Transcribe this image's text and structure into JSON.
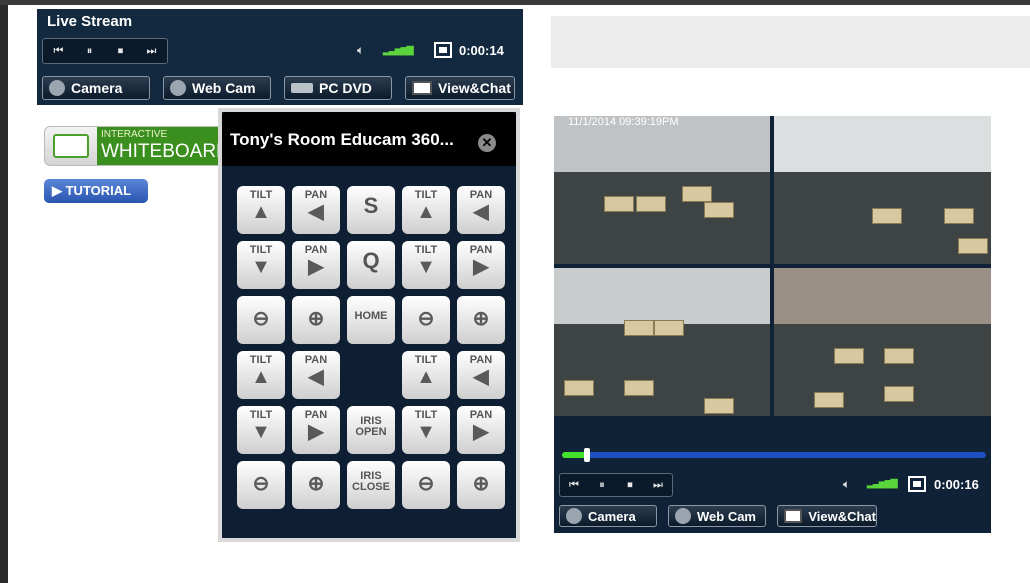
{
  "live": {
    "title": "Live Stream",
    "time": "0:00:14",
    "transport": [
      "⏮",
      "⏸",
      "⏹",
      "⏭"
    ],
    "sources": [
      "Camera",
      "Web Cam",
      "PC DVD",
      "View&Chat"
    ]
  },
  "whiteboard": {
    "small": "INTERACTIVE",
    "big": "WHITEBOARD"
  },
  "tutorial": "▶ TUTORIAL",
  "popup": {
    "title": "Tony's Room Educam 360...",
    "close": "✕",
    "pads": [
      {
        "top": "TILT",
        "glyph": "▲"
      },
      {
        "top": "PAN",
        "glyph": "◀"
      },
      {
        "big": "S"
      },
      {
        "top": "TILT",
        "glyph": "▲"
      },
      {
        "top": "PAN",
        "glyph": "◀"
      },
      {
        "top": "TILT",
        "glyph": "▼"
      },
      {
        "top": "PAN",
        "glyph": "▶"
      },
      {
        "big": "Q"
      },
      {
        "top": "TILT",
        "glyph": "▼"
      },
      {
        "top": "PAN",
        "glyph": "▶"
      },
      {
        "glyph": "⊖"
      },
      {
        "glyph": "⊕"
      },
      {
        "mid": "HOME"
      },
      {
        "glyph": "⊖"
      },
      {
        "glyph": "⊕"
      },
      {
        "top": "TILT",
        "glyph": "▲"
      },
      {
        "top": "PAN",
        "glyph": "◀"
      },
      null,
      {
        "top": "TILT",
        "glyph": "▲"
      },
      {
        "top": "PAN",
        "glyph": "◀"
      },
      {
        "top": "TILT",
        "glyph": "▼"
      },
      {
        "top": "PAN",
        "glyph": "▶"
      },
      {
        "two": [
          "IRIS",
          "OPEN"
        ]
      },
      {
        "top": "TILT",
        "glyph": "▼"
      },
      {
        "top": "PAN",
        "glyph": "▶"
      },
      {
        "glyph": "⊖"
      },
      {
        "glyph": "⊕"
      },
      {
        "two": [
          "IRIS",
          "CLOSE"
        ]
      },
      {
        "glyph": "⊖"
      },
      {
        "glyph": "⊕"
      }
    ]
  },
  "player": {
    "osd": "11/1/2014 09:39:19PM",
    "time": "0:00:16",
    "progress": 0.06,
    "transport": [
      "⏮",
      "⏸",
      "⏹",
      "⏭"
    ],
    "sources": [
      "Camera",
      "Web Cam",
      "View&Chat"
    ]
  },
  "colors": {
    "panel": "#12293f",
    "accent_green": "#45e02c",
    "seek_blue": "#1c4fbf"
  }
}
